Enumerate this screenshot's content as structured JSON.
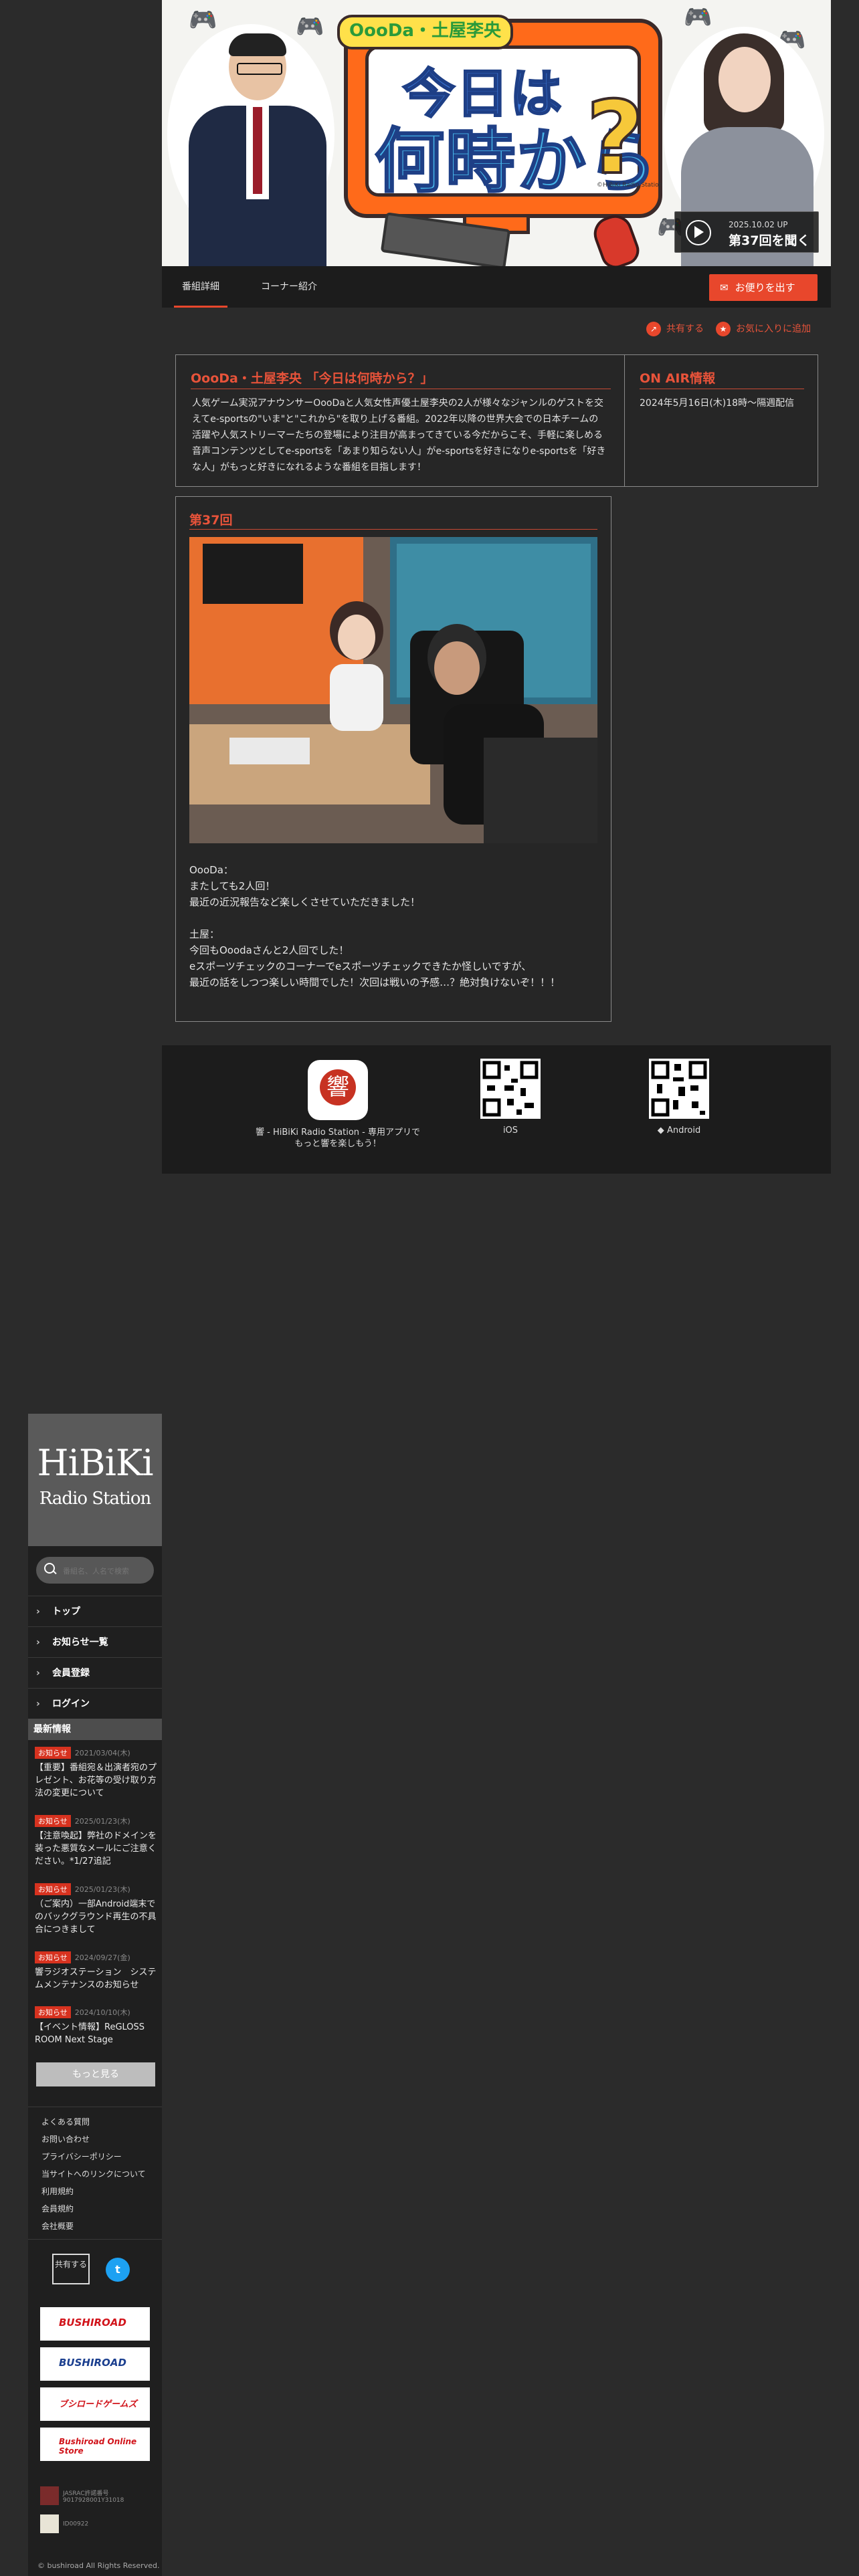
{
  "banner": {
    "logo_tag": "OooDa・土屋李央",
    "logo_line1": "今日は",
    "logo_line2": "何時から",
    "logo_q": "?",
    "copyright": "©HiBiKi Radio Station",
    "play_date": "2025.10.02 UP",
    "play_title": "第37回を聞く"
  },
  "tabs": [
    {
      "label": "番組詳細",
      "active": true
    },
    {
      "label": "コーナー紹介",
      "active": false
    }
  ],
  "letter_button": "お便りを出す",
  "actions": {
    "share": "共有する",
    "favorite": "お気に入りに追加"
  },
  "program": {
    "title": "OooDa・土屋李央 「今日は何時から？」",
    "description": "人気ゲーム実況アナウンサーOooDaと人気女性声優土屋李央の2人が様々なジャンルのゲストを交えてe-sportsの\"いま\"と\"これから\"を取り上げる番組。2022年以降の世界大会での日本チームの活躍や人気ストリーマーたちの登場により注目が高まってきている今だからこそ、手軽に楽しめる音声コンテンツとしてe-sportsを「あまり知らない人」がe-sportsを好きになりe-sportsを「好きな人」がもっと好きになれるような番組を目指します！"
  },
  "on_air": {
    "title": "ON AIR情報",
    "text": "2024年5月16日(木)18時〜隔週配信"
  },
  "episode": {
    "title": "第37回",
    "body": "OooDa：\nまたしても2人回！\n最近の近況報告など楽しくさせていただきました！\n\n土屋：\n今回もOoodaさんと2人回でした！\neスポーツチェックのコーナーでeスポーツチェックできたか怪しいですが、\n最近の話をしつつ楽しい時間でした！次回は戦いの予感…？絶対負けないぞ！！！"
  },
  "app_strip": {
    "app_caption_1": "響 - HiBiKi Radio Station - 専用アプリで",
    "app_caption_2": "もっと響を楽しもう！",
    "ios_label": "iOS",
    "android_label": "Android"
  },
  "sidebar": {
    "logo_line1": "HiBiKi",
    "logo_line2": "Radio Station",
    "search_placeholder": "番組名、人名で検索",
    "nav": [
      "トップ",
      "お知らせ一覧",
      "会員登録",
      "ログイン"
    ],
    "news_heading": "最新情報",
    "news": [
      {
        "tag": "お知らせ",
        "date": "2021/03/04(木)",
        "text": "【重要】番組宛＆出演者宛のプレゼント、お花等の受け取り方法の変更について"
      },
      {
        "tag": "お知らせ",
        "date": "2025/01/23(木)",
        "text": "【注意喚起】弊社のドメインを装った悪質なメールにご注意ください。*1/27追記"
      },
      {
        "tag": "お知らせ",
        "date": "2025/01/23(木)",
        "text": "（ご案内）一部Android端末でのバックグラウンド再生の不具合につきまして"
      },
      {
        "tag": "お知らせ",
        "date": "2024/09/27(金)",
        "text": "響ラジオステーション　システムメンテナンスのお知らせ"
      },
      {
        "tag": "お知らせ",
        "date": "2024/10/10(木)",
        "text": "【イベント情報】ReGLOSS ROOM Next Stage"
      }
    ],
    "more": "もっと見る",
    "footer_links": [
      "よくある質問",
      "お問い合わせ",
      "プライバシーポリシー",
      "当サイトへのリンクについて",
      "利用規約",
      "会員規約",
      "会社概要"
    ],
    "share": "共有する",
    "ads": [
      "BUSHIROAD",
      "BUSHIROAD",
      "ブシロードゲームズ",
      "Bushiroad Online Store"
    ],
    "cert1": "JASRAC許諾番号 9017928001Y31018",
    "cert2": "ID00922",
    "copyright": "© bushiroad All Rights Reserved."
  },
  "colors": {
    "accent": "#e8472c",
    "panel": "#262626",
    "bg": "#2b2b2b"
  }
}
